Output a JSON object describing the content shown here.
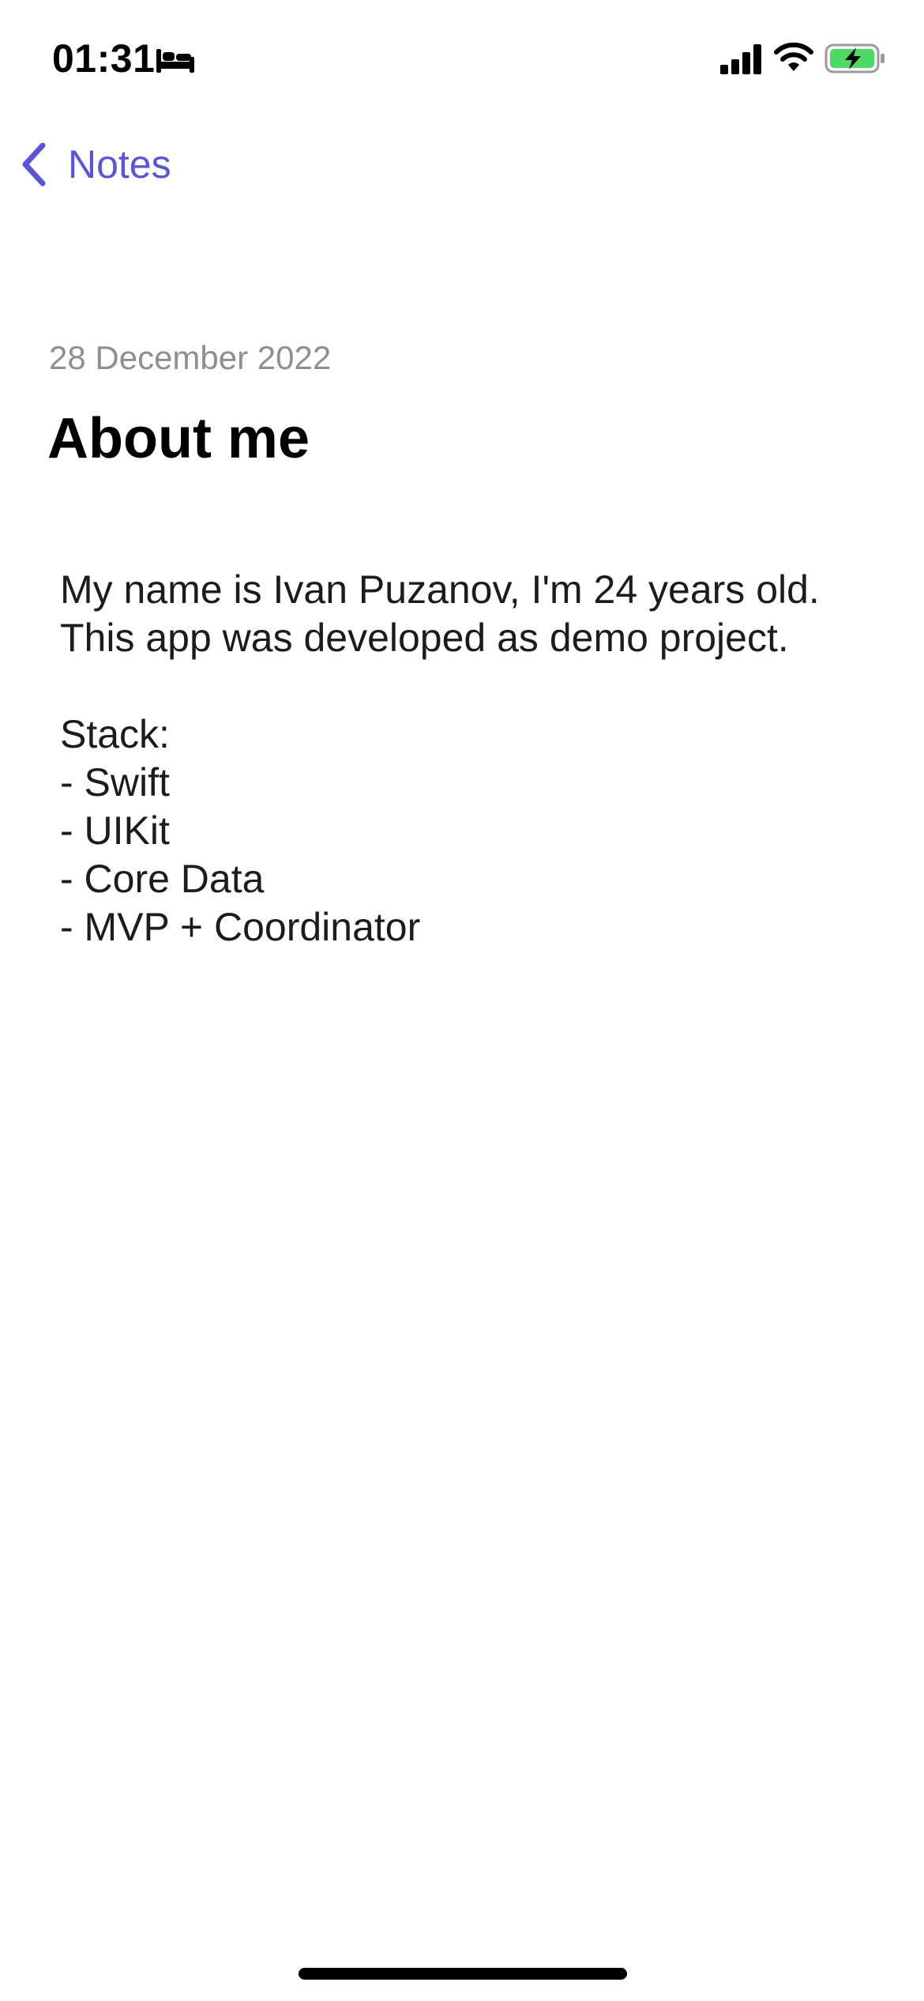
{
  "status_bar": {
    "time": "01:31",
    "focus_icon": "bed-icon",
    "signal_icon": "cellular-signal-icon",
    "wifi_icon": "wifi-icon",
    "battery_icon": "battery-charging-icon"
  },
  "navigation": {
    "back_label": "Notes",
    "back_icon": "chevron-left-icon"
  },
  "note": {
    "date": "28 December 2022",
    "title": "About me",
    "body_lines": [
      "My name is Ivan Puzanov, I'm 24 years old.",
      "This app was developed as demo project.",
      "",
      "Stack:",
      "- Swift",
      "- UIKit",
      "- Core Data",
      "- MVP + Coordinator"
    ]
  },
  "colors": {
    "accent": "#5856d6",
    "battery_fill": "#4cd964",
    "secondary_text": "#8e8e93"
  }
}
